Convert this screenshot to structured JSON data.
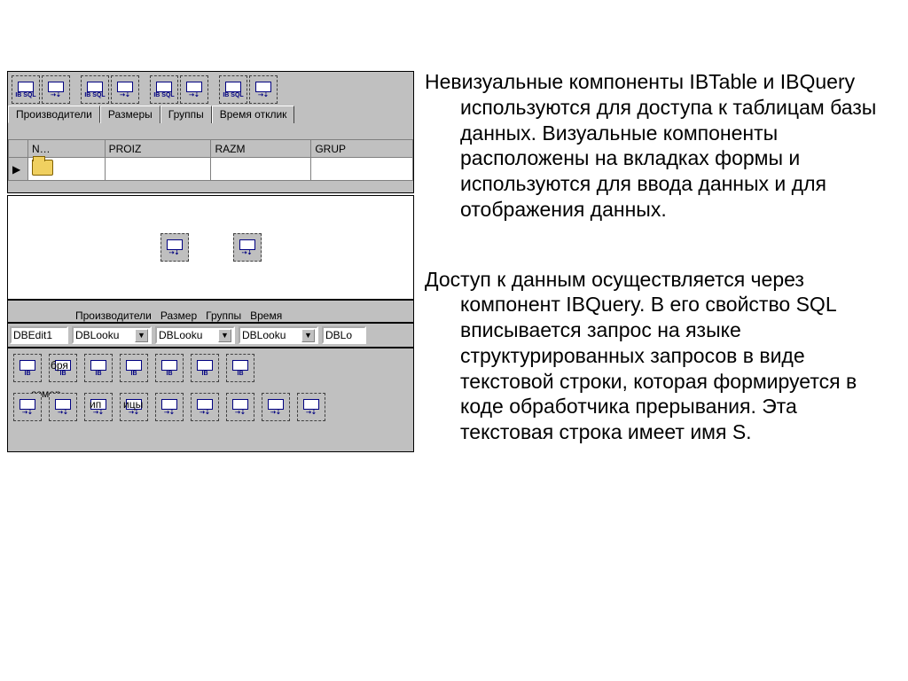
{
  "upper": {
    "pairLabels": [
      "IB SQL",
      "",
      "IB SQL",
      "",
      "IB SQL",
      "",
      "IB SQL",
      ""
    ],
    "tabs": [
      "Производители",
      "Размеры",
      "Группы",
      "Время отклик"
    ],
    "gridHeaders": [
      "N…",
      "PROIZ",
      "RAZM",
      "GRUP"
    ]
  },
  "labelsRow": [
    "Производители",
    "Размер",
    "Группы",
    "Время"
  ],
  "editsRow": {
    "dbedit": "DBEdit1",
    "dblook": [
      "DBLooku",
      "DBLooku",
      "DBLooku",
      "DBLo"
    ]
  },
  "bottomOverlay": {
    "l1": "бря",
    "l2": "-азмер",
    "l3": "ип",
    "l4": "ицы"
  },
  "text": {
    "p1": "Невизуальные компоненты IBTable и IBQuery используются для доступа к таблицам базы данных. Визуальные компоненты расположены на вкладках формы и используются для ввода данных и для отображения данных.",
    "p2": "Доступ к данным осуществляется через компонент IBQuery. В его свойство SQL вписывается запрос на языке структурированных запросов в виде текстовой строки, которая формируется в коде обработчика прерывания. Эта текстовая строка имеет имя S."
  },
  "iconLabel": "IB"
}
